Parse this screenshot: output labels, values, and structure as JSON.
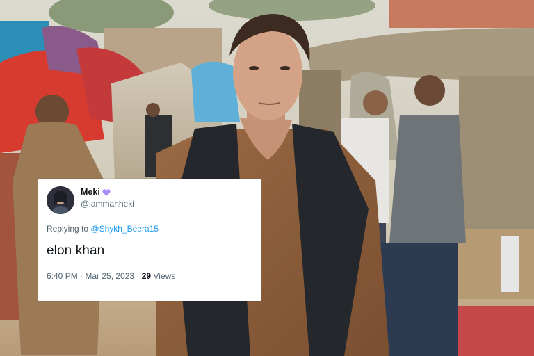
{
  "tweet": {
    "display_name": "Meki",
    "name_emoji": "purple-heart-icon",
    "handle": "@iammahheki",
    "replying_prefix": "Replying to",
    "replying_to": "@Shykh_Beera15",
    "text": "elon khan",
    "timestamp": "6:40 PM · Mar 25, 2023",
    "separator": " · ",
    "views_count": "29",
    "views_label": " Views"
  },
  "colors": {
    "link": "#1d9bf0",
    "secondary_text": "#536471",
    "primary_text": "#0f1419",
    "emoji_purple": "#a78bfa"
  }
}
